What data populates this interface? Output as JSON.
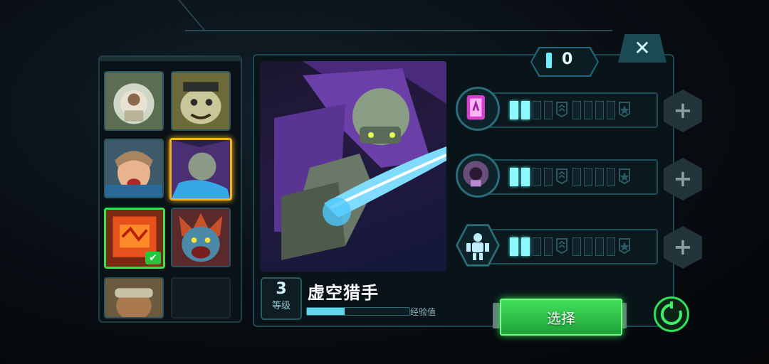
{
  "roster": {
    "heroes": [
      {
        "name": "hero-astronaut",
        "state": "normal"
      },
      {
        "name": "hero-bulldog",
        "state": "normal"
      },
      {
        "name": "hero-warrior-woman",
        "state": "normal"
      },
      {
        "name": "hero-void-hunter",
        "state": "selected"
      },
      {
        "name": "hero-robot",
        "state": "equipped"
      },
      {
        "name": "hero-troll",
        "state": "normal"
      },
      {
        "name": "hero-goggles",
        "state": "normal"
      },
      {
        "name": "empty",
        "state": "empty"
      }
    ]
  },
  "points": {
    "value": "0"
  },
  "hero": {
    "level": "3",
    "level_label": "等级",
    "name": "虚空猎手",
    "xp_label": "经验值",
    "xp_fraction": 0.37
  },
  "skills": [
    {
      "icon": "portal-icon",
      "level": 2,
      "max": 10
    },
    {
      "icon": "gauntlet-icon",
      "level": 2,
      "max": 10
    },
    {
      "icon": "robot-icon",
      "level": 2,
      "max": 10
    }
  ],
  "actions": {
    "select_label": "选择",
    "close_glyph": "✕",
    "plus_glyph": "+",
    "check_glyph": "✔"
  },
  "colors": {
    "accent": "#6ff0ff",
    "select_green": "#2bd34a",
    "selected_gold": "#f2b21f"
  }
}
